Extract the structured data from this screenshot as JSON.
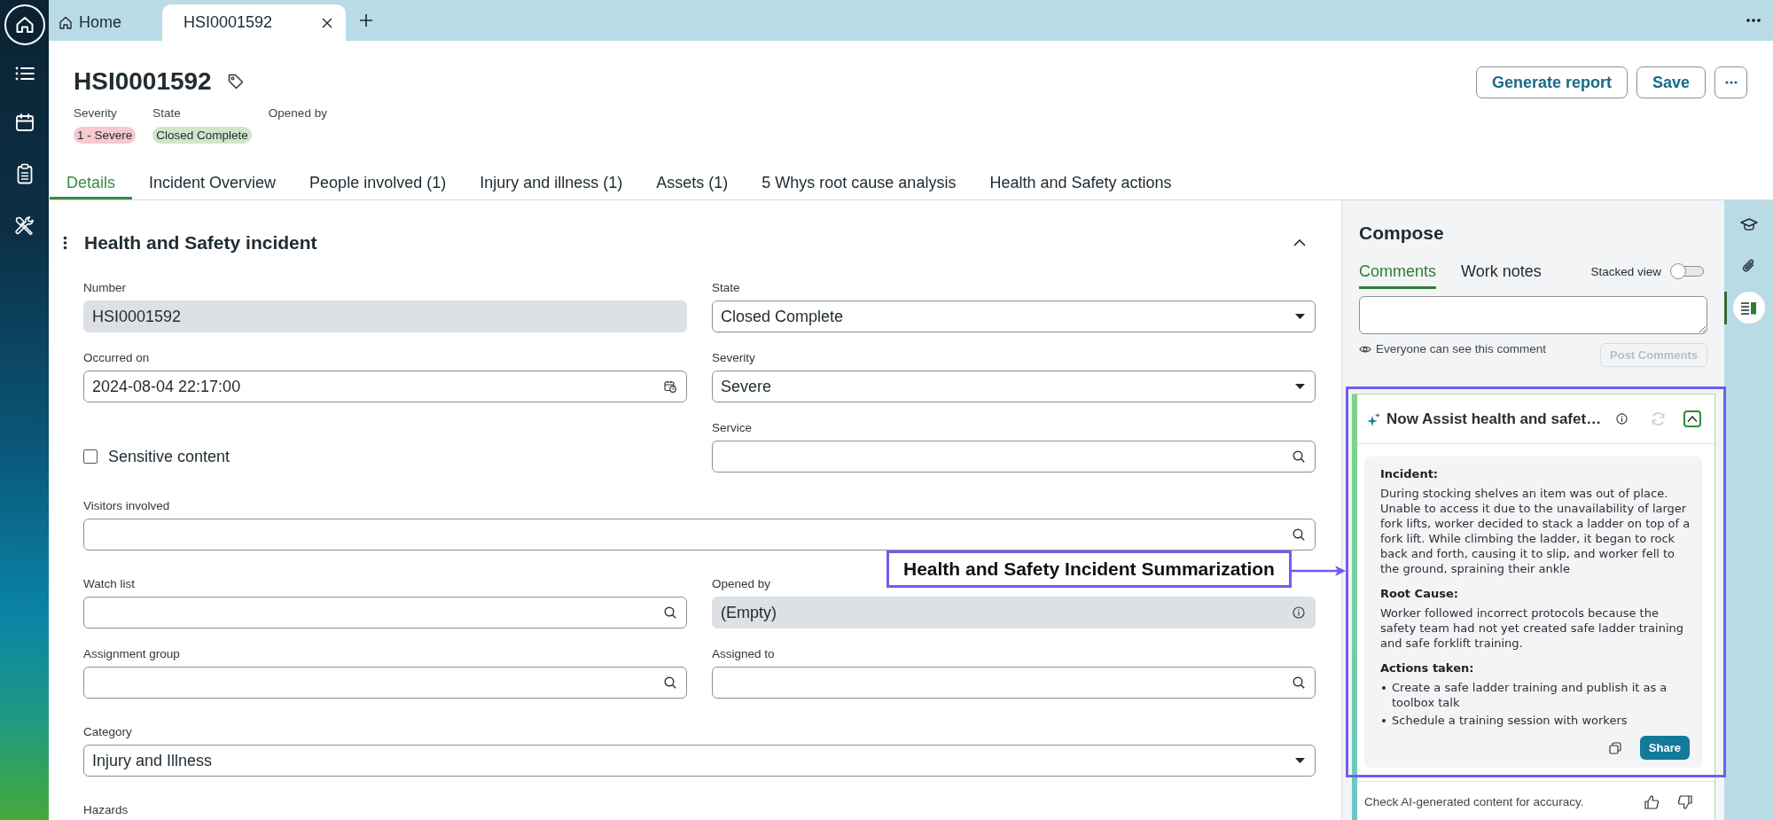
{
  "tabs": [
    {
      "label": "Home",
      "kind": "home",
      "selected": false
    },
    {
      "label": "HSI0001592",
      "kind": "record",
      "selected": true
    }
  ],
  "header": {
    "title": "HSI0001592",
    "meta": [
      {
        "label": "Severity",
        "value": "1 - Severe",
        "color": "#f7c9ce"
      },
      {
        "label": "State",
        "value": "Closed Complete",
        "color": "#cfe6c9"
      },
      {
        "label": "Opened by"
      }
    ],
    "buttons": [
      "Generate report",
      "Save"
    ]
  },
  "record_tabs": [
    {
      "label": "Details",
      "selected": true
    },
    {
      "label": "Incident Overview",
      "selected": false
    },
    {
      "label": "People involved (1)",
      "selected": false
    },
    {
      "label": "Injury and illness (1)",
      "selected": false
    },
    {
      "label": "Assets (1)",
      "selected": false
    },
    {
      "label": "5 Whys root cause analysis",
      "selected": false
    },
    {
      "label": "Health and Safety actions",
      "selected": false
    }
  ],
  "form": {
    "title": "Health and Safety incident",
    "expanded": true,
    "rows": [
      {
        "cells": [
          {
            "label": "Number",
            "kind": "readonly",
            "value": "HSI0001592",
            "info": false
          },
          {
            "label": "State",
            "kind": "select",
            "value": "Closed Complete"
          }
        ]
      },
      {
        "cells": [
          {
            "label": "Occurred on",
            "kind": "date",
            "value": "2024-08-04 22:17:00"
          },
          {
            "label": "Severity",
            "kind": "select",
            "value": "Severe"
          }
        ]
      },
      {
        "cells": [
          {
            "label": "Sensitive content",
            "kind": "checkbox",
            "checked": false
          },
          {
            "label": "Service",
            "kind": "reference"
          }
        ]
      },
      {
        "cells": [
          {
            "label": "Visitors involved",
            "kind": "reference"
          }
        ]
      },
      {
        "cells": [
          {
            "label": "Watch list",
            "kind": "reference"
          },
          {
            "label": "Opened by",
            "kind": "readonly",
            "value": "(Empty)",
            "info": true
          }
        ]
      },
      {
        "cells": [
          {
            "label": "Assignment group",
            "kind": "reference"
          },
          {
            "label": "Assigned to",
            "kind": "reference"
          }
        ]
      },
      {
        "cells": [
          {
            "label": "Category",
            "kind": "select",
            "value": "Injury and Illness"
          }
        ]
      },
      {
        "cells": [
          {
            "label": "Hazards",
            "kind": "label"
          }
        ]
      }
    ]
  },
  "compose": {
    "title": "Compose",
    "tabs": [
      {
        "label": "Comments",
        "selected": true
      },
      {
        "label": "Work notes",
        "selected": false
      }
    ],
    "stacked_view": {
      "label": "Stacked view",
      "on": false
    },
    "visibility_note": "Everyone can see this comment",
    "post_button": {
      "label": "Post Comments",
      "disabled": true
    }
  },
  "assist_card": {
    "title": "Now Assist health and safet…",
    "expanded": true,
    "sections": [
      {
        "heading": "Incident:",
        "kind": "paragraph",
        "text": "During stocking shelves an item was out of place. Unable to access it due to the unavailability of larger fork lifts, worker decided to stack a ladder on top of a fork lift. While climbing the ladder, it began to rock back and forth, causing it to slip, and worker fell to the ground, spraining their ankle"
      },
      {
        "heading": "Root Cause:",
        "kind": "paragraph",
        "text": "Worker followed incorrect protocols because the safety team had not yet created safe ladder training and safe forklift training."
      },
      {
        "heading": "Actions taken:",
        "kind": "list",
        "items": [
          "Create a safe ladder training and publish it as a toolbox talk",
          "Schedule a training session with workers"
        ]
      }
    ],
    "share_button": "Share",
    "disclaimer": "Check AI-generated content for accuracy."
  },
  "side_rail": [
    {
      "selected": false
    },
    {
      "selected": false
    },
    {
      "selected": true
    }
  ],
  "annotation": {
    "label": "Health and Safety Incident Summarization"
  }
}
